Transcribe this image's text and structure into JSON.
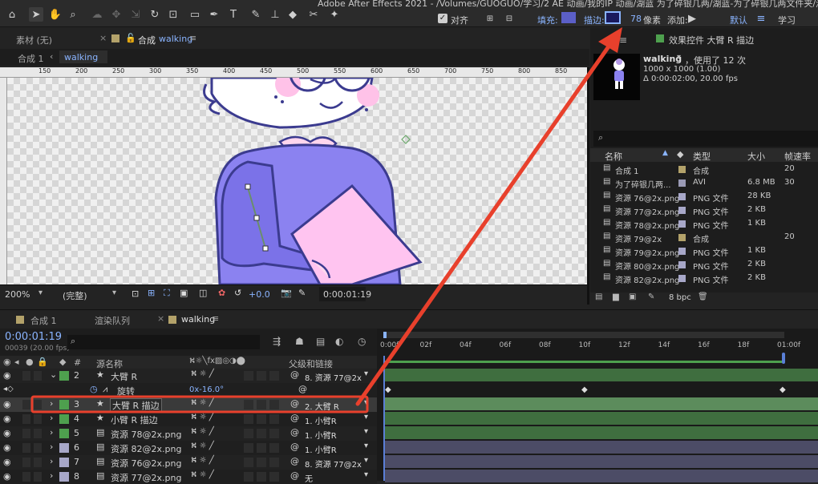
{
  "title": "Adobe After Effects 2021 - /Volumes/GUOGUO/学习/2 AE 动画/我的IP 动画/湖蓝 为了碎银几两/湖蓝-为了碎银几两文件夹/湖蓝-为了",
  "toolbar": {
    "align_label": "对齐",
    "fill_label": "填充:",
    "stroke_label": "描边:",
    "stroke_value": "78",
    "stroke_unit": "像素",
    "add_label": "添加:",
    "workspace_default": "默认",
    "workspace_learn": "学习",
    "fill_color": "#5b5fc7",
    "stroke_color": "#1a1a5e"
  },
  "comp_panel": {
    "tab_footage": "素材 (无)",
    "tab_comp_prefix": "合成",
    "tab_comp_name": "walking",
    "crumb_parent": "合成 1",
    "crumb_current": "walking",
    "ruler_ticks": [
      "150",
      "200",
      "250",
      "300",
      "350",
      "400",
      "450",
      "500",
      "550",
      "600",
      "650",
      "700",
      "750",
      "800",
      "850"
    ],
    "zoom": "200%",
    "quality": "(完整)",
    "exposure": "+0.0",
    "time": "0:00:01:19"
  },
  "project_panel": {
    "tab": "效果控件 大臂 R 描边",
    "comp_name": "walking",
    "usage": "，使用了 12 次",
    "size": "1000 x 1000 (1.00)",
    "duration": "Δ 0:00:02:00, 20.00 fps",
    "search_placeholder": "",
    "headers": {
      "name": "名称",
      "type": "类型",
      "size": "大小",
      "fps": "帧速率"
    },
    "items": [
      {
        "name": "合成 1",
        "type": "合成",
        "size": "",
        "fps": "20",
        "color": "#b3a26a"
      },
      {
        "name": "为了碎银几两...",
        "type": "AVI",
        "size": "6.8 MB",
        "fps": "30",
        "color": "#9a9ab5"
      },
      {
        "name": "资源 76@2x.png",
        "type": "PNG 文件",
        "size": "28 KB",
        "fps": "",
        "color": "#a7a7c8"
      },
      {
        "name": "资源 77@2x.png",
        "type": "PNG 文件",
        "size": "2 KB",
        "fps": "",
        "color": "#a7a7c8"
      },
      {
        "name": "资源 78@2x.png",
        "type": "PNG 文件",
        "size": "1 KB",
        "fps": "",
        "color": "#a7a7c8"
      },
      {
        "name": "资源 79@2x",
        "type": "合成",
        "size": "",
        "fps": "20",
        "color": "#b3a26a"
      },
      {
        "name": "资源 79@2x.png",
        "type": "PNG 文件",
        "size": "1 KB",
        "fps": "",
        "color": "#a7a7c8"
      },
      {
        "name": "资源 80@2x.png",
        "type": "PNG 文件",
        "size": "2 KB",
        "fps": "",
        "color": "#a7a7c8"
      },
      {
        "name": "资源 82@2x.png",
        "type": "PNG 文件",
        "size": "2 KB",
        "fps": "",
        "color": "#a7a7c8"
      }
    ],
    "bpc": "8 bpc"
  },
  "timeline": {
    "tab1": "合成 1",
    "tab2": "渲染队列",
    "tab3": "walking",
    "timecode": "0:00:01:19",
    "frames": "00039 (20.00 fps)",
    "col_number": "#",
    "col_source": "源名称",
    "col_parent": "父级和链接",
    "ruler": [
      "0:00f",
      "02f",
      "04f",
      "06f",
      "08f",
      "10f",
      "12f",
      "14f",
      "16f",
      "18f",
      "01:00f"
    ],
    "layers": [
      {
        "num": "2",
        "name": "大臂 R",
        "parent": "8. 资源 77@2x",
        "color": "#4ea04e",
        "star": true,
        "expanded": true,
        "selected": false
      },
      {
        "num": "",
        "name": "旋转",
        "parent": "",
        "color": "",
        "star": false,
        "sub": true,
        "value": "0x-16.0°"
      },
      {
        "num": "3",
        "name": "大臂 R 描边",
        "parent": "2. 大臂 R",
        "color": "#4ea04e",
        "star": true,
        "selected": true
      },
      {
        "num": "4",
        "name": "小臂 R 描边",
        "parent": "1. 小臂R",
        "color": "#4ea04e",
        "star": true
      },
      {
        "num": "5",
        "name": "资源 78@2x.png",
        "parent": "1. 小臂R",
        "color": "#4ea04e",
        "star": false
      },
      {
        "num": "6",
        "name": "资源 82@2x.png",
        "parent": "1. 小臂R",
        "color": "#a7a7c8",
        "star": false
      },
      {
        "num": "7",
        "name": "资源 76@2x.png",
        "parent": "8. 资源 77@2x",
        "color": "#a7a7c8",
        "star": false
      },
      {
        "num": "8",
        "name": "资源 77@2x.png",
        "parent": "无",
        "color": "#a7a7c8",
        "star": false
      }
    ]
  }
}
